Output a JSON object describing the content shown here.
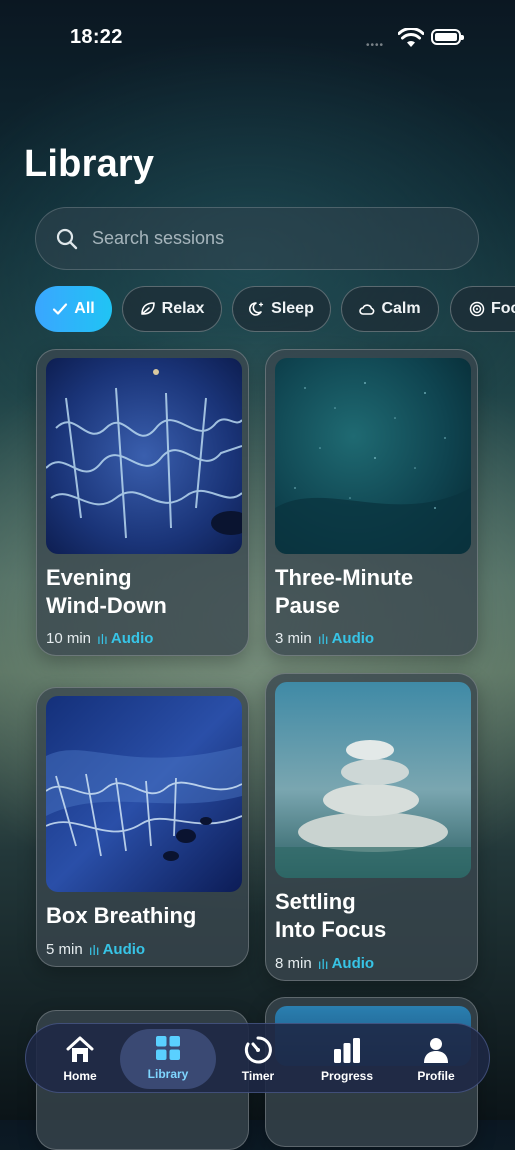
{
  "status_bar": {
    "time": "18:22"
  },
  "header": {
    "title": "Library"
  },
  "search": {
    "placeholder": "Search sessions"
  },
  "filters": [
    {
      "label": "All",
      "icon": "check-icon",
      "active": true
    },
    {
      "label": "Relax",
      "icon": "leaf-icon",
      "active": false
    },
    {
      "label": "Sleep",
      "icon": "moon-icon",
      "active": false
    },
    {
      "label": "Calm",
      "icon": "cloud-icon",
      "active": false
    },
    {
      "label": "Focus",
      "icon": "target-icon",
      "active": false
    }
  ],
  "sessions": [
    {
      "title_line1": "Evening",
      "title_line2": "Wind-Down",
      "duration": "10 min",
      "type": "Audio"
    },
    {
      "title_line1": "Three-Minute",
      "title_line2": "Pause",
      "duration": "3 min",
      "type": "Audio"
    },
    {
      "title_line1": "Box Breathing",
      "title_line2": "",
      "duration": "5 min",
      "type": "Audio"
    },
    {
      "title_line1": "Settling",
      "title_line2": "Into Focus",
      "duration": "8 min",
      "type": "Audio"
    }
  ],
  "nav": [
    {
      "label": "Home",
      "icon": "home-icon",
      "active": false
    },
    {
      "label": "Library",
      "icon": "grid-icon",
      "active": true
    },
    {
      "label": "Timer",
      "icon": "timer-icon",
      "active": false
    },
    {
      "label": "Progress",
      "icon": "bar-chart-icon",
      "active": false
    },
    {
      "label": "Profile",
      "icon": "person-icon",
      "active": false
    }
  ],
  "colors": {
    "accent": "#20c4f4",
    "audio_label": "#37c4e6",
    "nav_active": "#7fd6ff"
  }
}
